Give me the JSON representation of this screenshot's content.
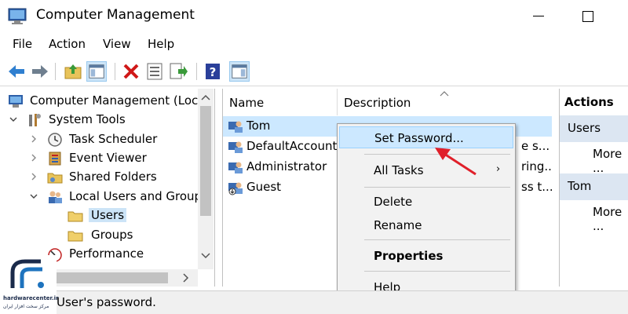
{
  "window": {
    "title": "Computer Management"
  },
  "menu": [
    "File",
    "Action",
    "View",
    "Help"
  ],
  "tree": {
    "items": [
      {
        "label": "Computer Management (Loca"
      },
      {
        "label": "System Tools"
      },
      {
        "label": "Task Scheduler"
      },
      {
        "label": "Event Viewer"
      },
      {
        "label": "Shared Folders"
      },
      {
        "label": "Local Users and Group"
      },
      {
        "label": "Users"
      },
      {
        "label": "Groups"
      },
      {
        "label": "Performance"
      }
    ]
  },
  "list": {
    "columns": [
      "Name",
      "Description"
    ],
    "rows": [
      {
        "name": "Tom",
        "desc": ""
      },
      {
        "name": "DefaultAccount",
        "desc": "e s..."
      },
      {
        "name": "Administrator",
        "desc": "ring..."
      },
      {
        "name": "Guest",
        "desc": "ss t..."
      }
    ]
  },
  "actions": {
    "title": "Actions",
    "sections": [
      {
        "label": "Users",
        "item": "More ..."
      },
      {
        "label": "Tom",
        "item": "More ..."
      }
    ]
  },
  "context_menu": {
    "items": [
      "Set Password...",
      "All Tasks",
      "Delete",
      "Rename",
      "Properties",
      "Help"
    ]
  },
  "status": {
    "text": "User's password."
  },
  "logo": {
    "name": "hardwarecenter.ir",
    "sub": "مرکز سخت افزار ایران"
  },
  "colors": {
    "selection": "#cce8ff",
    "accent": "#1e73be",
    "pointer": "#e0202a"
  }
}
